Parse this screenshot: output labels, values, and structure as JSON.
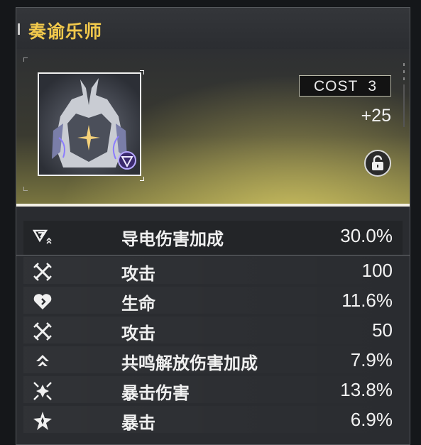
{
  "echo": {
    "name": "奏谕乐师",
    "cost_label": "COST",
    "cost_value": "3",
    "level": "+25",
    "element_icon": "electro-element-icon",
    "lock_icon": "lock-open-icon"
  },
  "stats": [
    {
      "name": "导电伤害加成",
      "value": "30.0%",
      "icon": "electro-damage-icon"
    },
    {
      "name": "攻击",
      "value": "100",
      "icon": "attack-swords-icon"
    },
    {
      "name": "生命",
      "value": "11.6%",
      "icon": "hp-heart-icon"
    },
    {
      "name": "攻击",
      "value": "50",
      "icon": "attack-swords-icon"
    },
    {
      "name": "共鸣解放伤害加成",
      "value": "7.9%",
      "icon": "resonance-liberation-icon"
    },
    {
      "name": "暴击伤害",
      "value": "13.8%",
      "icon": "crit-damage-icon"
    },
    {
      "name": "暴击",
      "value": "6.9%",
      "icon": "crit-rate-icon"
    }
  ],
  "colors": {
    "title": "#f2c94c",
    "panel": "#2a2c30",
    "hero_glow": "#f0e16e"
  }
}
